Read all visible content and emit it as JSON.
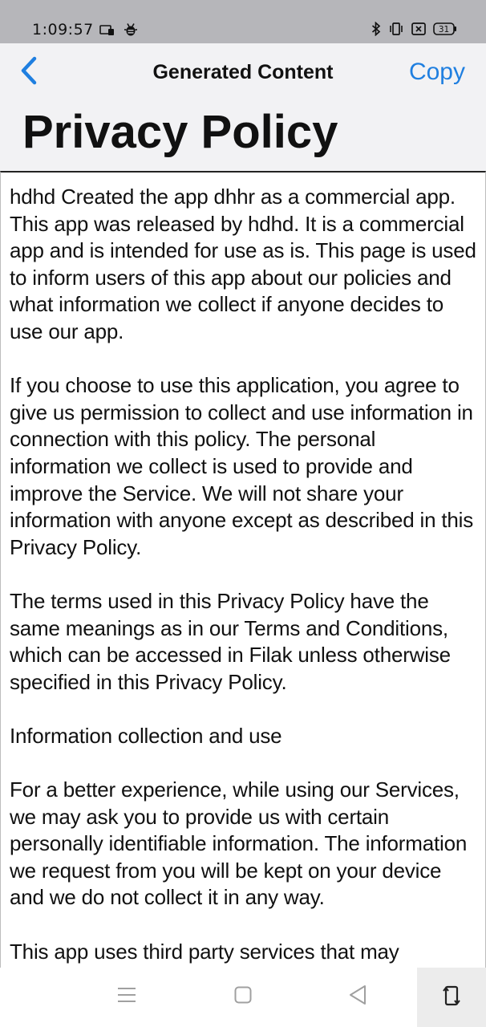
{
  "status_bar": {
    "time": "1:09:57",
    "battery": "31",
    "icons": [
      "cast-icon",
      "bug-icon",
      "bluetooth-icon",
      "vibrate-icon",
      "screenshot-icon",
      "battery-icon"
    ]
  },
  "header": {
    "back_icon": "chevron-left-icon",
    "title": "Generated Content",
    "copy_label": "Copy",
    "accent_color": "#1f7fe0"
  },
  "page": {
    "title": "Privacy Policy"
  },
  "content": {
    "paragraphs": [
      "hdhd Created the app dhhr as a commercial app. This app was released by hdhd. It is a commercial app and is intended for use as is. This page is used to inform users of this app about our policies and what information we collect if anyone decides to use our app.",
      "If you choose to use this application, you agree to give us permission to collect and use information in connection with this policy. The personal information we collect is used to provide and improve the Service. We will not share your information with anyone except as described in this Privacy Policy.",
      "The terms used in this Privacy Policy have the same meanings as in our Terms and Conditions, which can be accessed in Filak unless otherwise specified in this Privacy Policy.",
      "Information collection and use",
      "For a better experience, while using our Services, we may ask you to provide us with certain personally identifiable information. The information we request from you will be kept on your device and we do not collect it in any way.",
      "This app uses third party services that may"
    ]
  },
  "nav_bar": {
    "icons": [
      "menu-icon",
      "home-icon",
      "back-triangle-icon",
      "rotate-screen-icon"
    ]
  }
}
